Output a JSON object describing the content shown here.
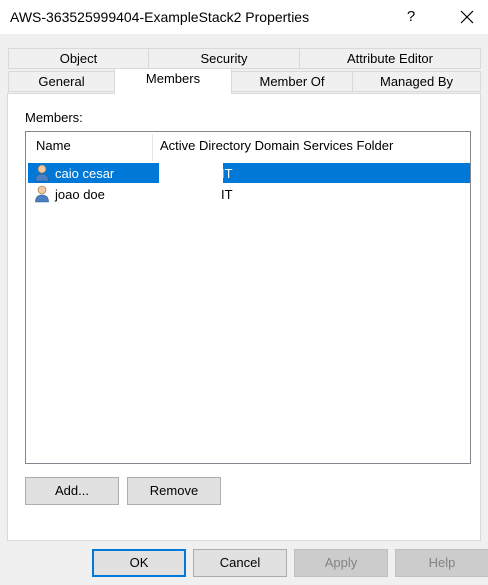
{
  "window": {
    "title": "AWS-363525999404-ExampleStack2 Properties",
    "help_glyph": "?"
  },
  "tabs": {
    "row1": [
      {
        "label": "Object"
      },
      {
        "label": "Security"
      },
      {
        "label": "Attribute Editor"
      }
    ],
    "row2": [
      {
        "label": "General"
      },
      {
        "label": "Members"
      },
      {
        "label": "Member Of"
      },
      {
        "label": "Managed By"
      }
    ],
    "active": "Members"
  },
  "members": {
    "label": "Members:",
    "columns": [
      "Name",
      "Active Directory Domain Services Folder"
    ],
    "rows": [
      {
        "name": "caio cesar",
        "folder": "IT",
        "selected": true
      },
      {
        "name": "joao doe",
        "folder": "IT",
        "selected": false
      }
    ],
    "add_label": "Add...",
    "remove_label": "Remove"
  },
  "footer": {
    "ok_label": "OK",
    "cancel_label": "Cancel",
    "apply_label": "Apply",
    "help_label": "Help"
  },
  "colors": {
    "selection": "#0078d7",
    "window_bg": "#f0f0f0"
  }
}
